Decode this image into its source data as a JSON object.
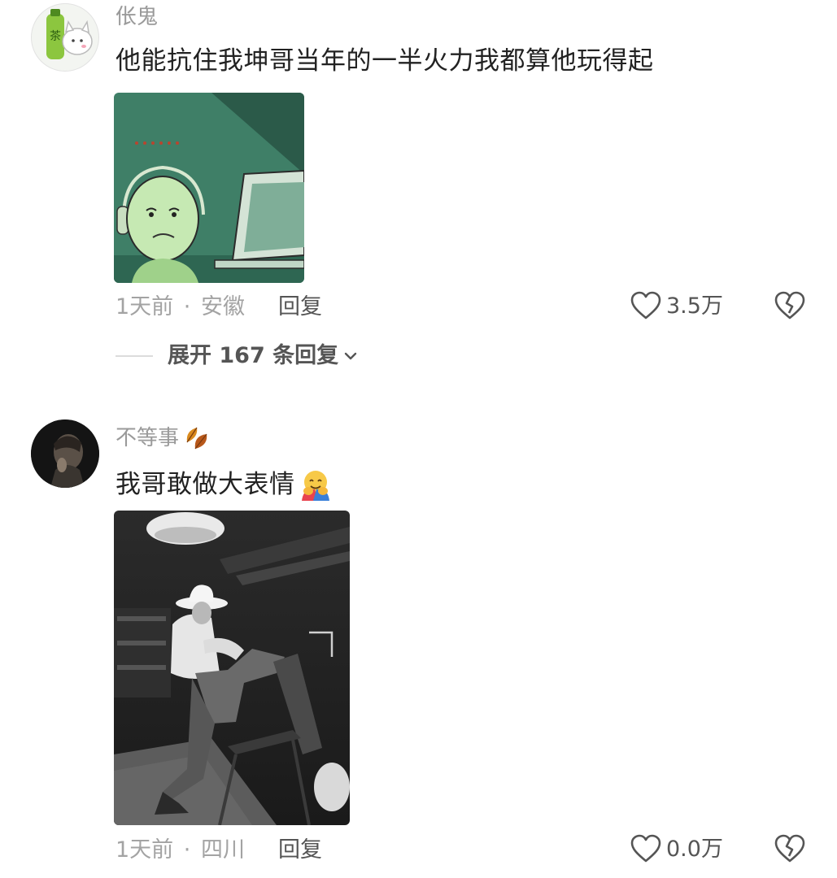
{
  "comments": [
    {
      "username": "伥鬼",
      "text": "他能抗住我坤哥当年的一半火力我都算他玩得起",
      "avatar_icon": "tea-bottle-cat-avatar",
      "image_icon": "green-meme-face-at-computer",
      "time": "1天前",
      "location": "安徽",
      "reply_label": "回复",
      "like_count": "3.5万",
      "expand_label": "展开 167 条回复"
    },
    {
      "username": "不等事",
      "badge_icon": "fallen-leaf-emoji",
      "text": "我哥敢做大表情",
      "text_emoji": "hugging-face-emoji",
      "avatar_icon": "dark-portrait-avatar",
      "image_icon": "bw-photo-man-cowboy-hat",
      "time": "1天前",
      "location": "四川",
      "reply_label": "回复",
      "like_count": "0.0万"
    }
  ],
  "separator": "·",
  "colors": {
    "username": "#9a9a9a",
    "meta": "#a3a3a3",
    "meme_bg": "#4f9a7a"
  }
}
